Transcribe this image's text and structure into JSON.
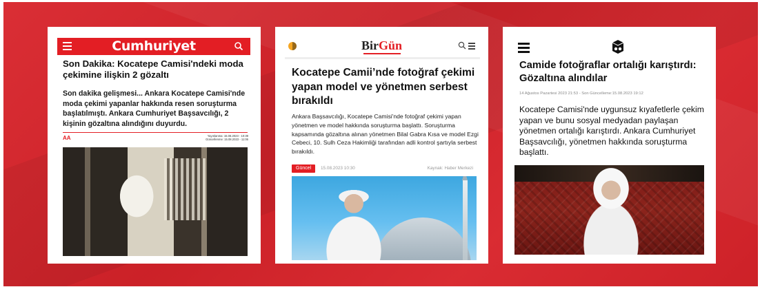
{
  "colors": {
    "background": "#d8232a",
    "cumhuriyet_red": "#e31e24",
    "birgun_accent": "#e31e24"
  },
  "card1": {
    "logo": "Cumhuriyet",
    "icons": [
      "menu-icon",
      "search-icon"
    ],
    "title": "Son Dakika: Kocatepe Camisi'ndeki moda çekimine ilişkin 2 gözaltı",
    "lead": "Son dakika gelişmesi... Ankara Kocatepe Camisi'nde moda çekimi yapanlar hakkında resen soruşturma başlatılmıştı. Ankara Cumhuriyet Başsavcılığı, 2 kişinin gözaltına alındığını duyurdu.",
    "source": "AA",
    "published": "Yayınlanma: 15.08.2023 - 10:39",
    "updated": "Güncellenme: 15.08.2023 - 11:06"
  },
  "card2": {
    "logo_part1": "Bir",
    "logo_part2": "Gün",
    "icons": [
      "brand-icon",
      "search-icon",
      "menu-icon"
    ],
    "title": "Kocatepe Camii’nde fotoğraf çekimi yapan model ve yönetmen serbest bırakıldı",
    "lead": "Ankara Başsavcılığı, Kocatepe Camisi'nde fotoğraf çekimi yapan yönetmen ve model hakkında soruşturma başlattı. Soruşturma kapsamında gözaltına alınan yönetmen Bilal Gabra Kısa ve model Ezgi Cebeci, 10. Sulh Ceza Hakimliği tarafından adli kontrol şartıyla serbest bırakıldı.",
    "category": "Güncel",
    "date": "15.08.2023 10:30",
    "source": "Kaynak: Haber Merkezi"
  },
  "card3": {
    "icons": [
      "menu-icon",
      "odatv-logo-icon"
    ],
    "title": "Camide fotoğraflar ortalığı karıştırdı: Gözaltına alındılar",
    "meta": "14 Ağustos Pazartesi 2023 21:53 - Son Güncelleme:15.08.2023 19:12",
    "lead": "Kocatepe Camisi'nde uygunsuz kıyafetlerle çekim yapan ve bunu sosyal medyadan paylaşan yönetmen ortalığı karıştırdı. Ankara Cumhuriyet Başsavcılığı, yönetmen hakkında soruşturma başlattı."
  }
}
